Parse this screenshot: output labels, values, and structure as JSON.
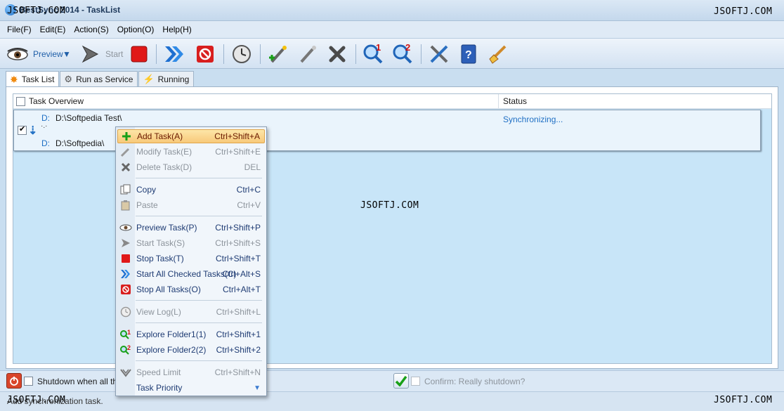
{
  "window": {
    "title": "BestSync 2014 - TaskList",
    "controls": [
      "–",
      "□",
      "✕"
    ]
  },
  "watermark": "JSOFTJ.COM",
  "menu": [
    "File(F)",
    "Edit(E)",
    "Action(S)",
    "Option(O)",
    "Help(H)"
  ],
  "toolbar": {
    "preview_label": "Preview",
    "start_label": "Start",
    "buttons": [
      "eye-icon",
      "start-icon",
      "stop-icon",
      "start-all-icon",
      "stop-all-icon",
      "view-log-icon",
      "add-task-icon",
      "modify-task-icon",
      "delete-task-icon",
      "explore-folder1-icon",
      "explore-folder2-icon",
      "settings-icon",
      "help-icon",
      "clean-icon"
    ]
  },
  "tabs": [
    {
      "label": "Task List",
      "icon": "star-icon",
      "active": true
    },
    {
      "label": "Run as Service",
      "icon": "gear-icon",
      "active": false
    },
    {
      "label": "Running",
      "icon": "lightning-icon",
      "active": false
    }
  ],
  "grid": {
    "col_overview": "Task Overview",
    "col_status": "Status",
    "rows": [
      {
        "checked": true,
        "source_drive": "D:",
        "source_path": "D:\\Softpedia Test\\",
        "dest_drive": "D:",
        "dest_path": "D:\\Softpedia\\",
        "status": "Synchronizing..."
      }
    ]
  },
  "context_menu": {
    "items": [
      {
        "label": "Add Task(A)",
        "shortcut": "Ctrl+Shift+A",
        "icon": "add-task-icon",
        "disabled": false,
        "highlighted": true
      },
      {
        "label": "Modify Task(E)",
        "shortcut": "Ctrl+Shift+E",
        "icon": "modify-task-icon",
        "disabled": true
      },
      {
        "label": "Delete Task(D)",
        "shortcut": "DEL",
        "icon": "delete-task-icon",
        "disabled": true
      },
      {
        "label": "Copy",
        "shortcut": "Ctrl+C",
        "icon": "copy-icon",
        "disabled": false
      },
      {
        "label": "Paste",
        "shortcut": "Ctrl+V",
        "icon": "paste-icon",
        "disabled": true
      },
      {
        "label": "Preview Task(P)",
        "shortcut": "Ctrl+Shift+P",
        "icon": "eye-icon",
        "disabled": false
      },
      {
        "label": "Start Task(S)",
        "shortcut": "Ctrl+Shift+S",
        "icon": "start-icon",
        "disabled": true
      },
      {
        "label": "Stop Task(T)",
        "shortcut": "Ctrl+Shift+T",
        "icon": "stop-icon",
        "disabled": false
      },
      {
        "label": "Start All Checked Tasks(C)",
        "shortcut": "Ctrl+Alt+S",
        "icon": "start-all-icon",
        "disabled": false
      },
      {
        "label": "Stop All Tasks(O)",
        "shortcut": "Ctrl+Alt+T",
        "icon": "stop-all-icon",
        "disabled": false
      },
      {
        "label": "View Log(L)",
        "shortcut": "Ctrl+Shift+L",
        "icon": "view-log-icon",
        "disabled": true
      },
      {
        "label": "Explore Folder1(1)",
        "shortcut": "Ctrl+Shift+1",
        "icon": "explore-folder1-icon",
        "disabled": false
      },
      {
        "label": "Explore Folder2(2)",
        "shortcut": "Ctrl+Shift+2",
        "icon": "explore-folder2-icon",
        "disabled": false
      },
      {
        "label": "Speed Limit",
        "shortcut": "Ctrl+Shift+N",
        "icon": "speed-limit-icon",
        "disabled": true
      },
      {
        "label": "Task Priority",
        "shortcut": "",
        "icon": "",
        "disabled": false,
        "submenu": true
      }
    ]
  },
  "bottom": {
    "shutdown_label": "Shutdown when all the t",
    "confirm_label": "Confirm: Really shutdown?",
    "status_text": "Add synchronization task."
  }
}
